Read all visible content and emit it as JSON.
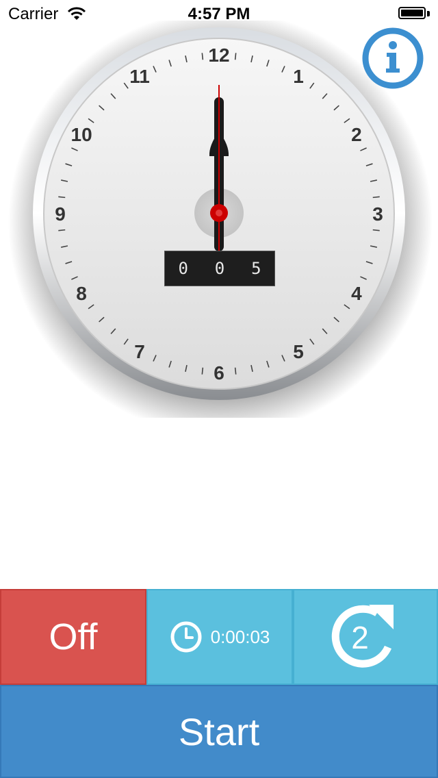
{
  "status_bar": {
    "carrier": "Carrier",
    "time": "4:57 PM"
  },
  "clock": {
    "numerals": [
      "12",
      "1",
      "2",
      "3",
      "4",
      "5",
      "6",
      "7",
      "8",
      "9",
      "10",
      "11"
    ],
    "counter_digits": [
      "0",
      "0",
      "5"
    ],
    "colors": {
      "needle": "#cc0000",
      "face": "#f2f2f2",
      "numeral": "#333333"
    }
  },
  "info_button": {
    "icon": "info-icon",
    "color": "#3c8fd0"
  },
  "controls": {
    "off_label": "Off",
    "timer_value": "0:00:03",
    "repeat_count": "2",
    "start_label": "Start",
    "colors": {
      "off": "#d9534f",
      "timer": "#5bc0de",
      "repeat": "#5bc0de",
      "start": "#428bca"
    }
  }
}
